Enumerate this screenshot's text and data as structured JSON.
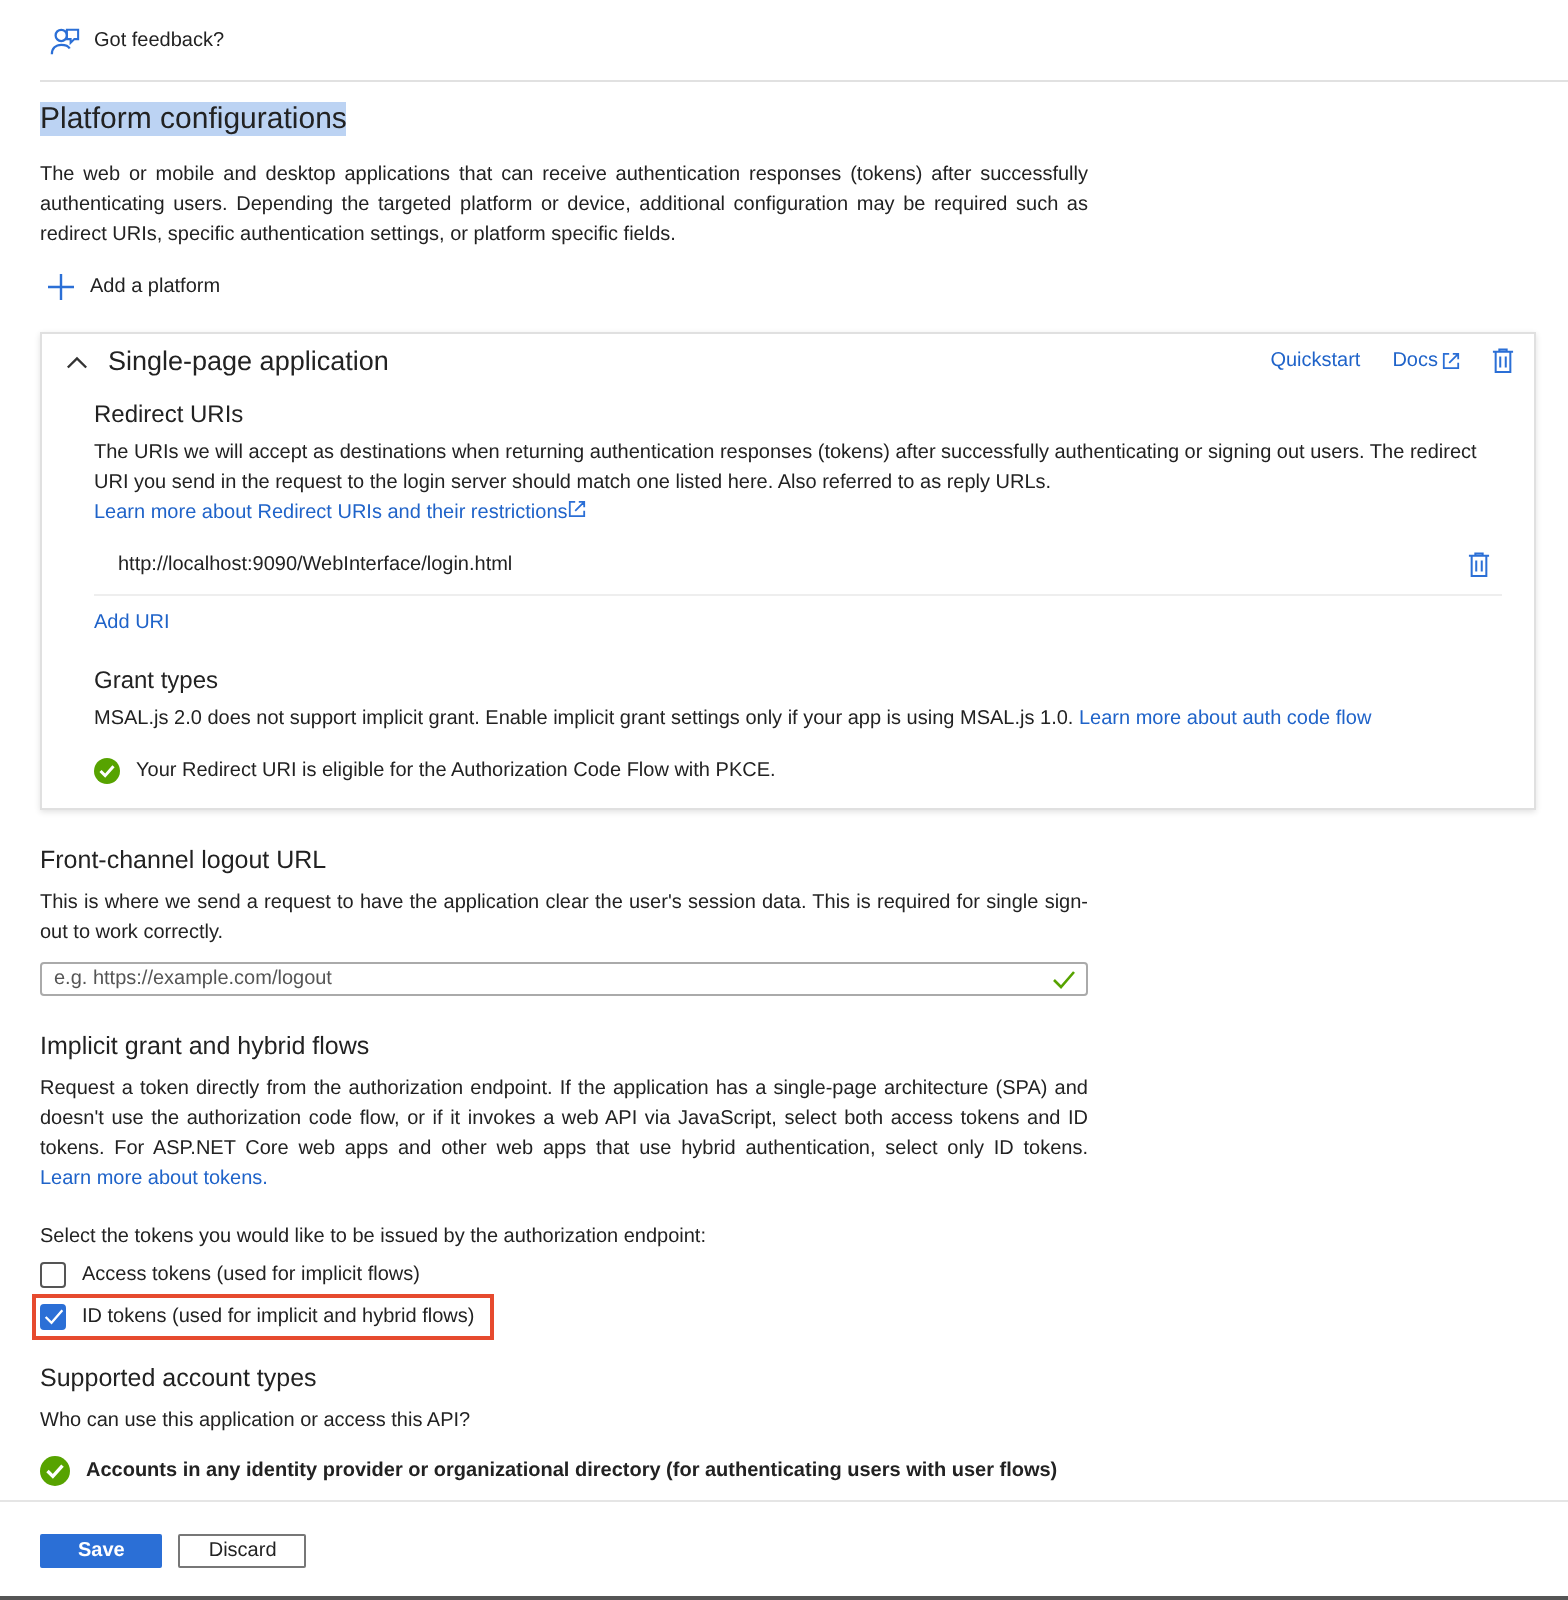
{
  "toolbar": {
    "feedback": "Got feedback?"
  },
  "title": {
    "text": "Platform configurations",
    "highlighted": true
  },
  "intro": "The web or mobile and desktop applications that can receive authentication responses (tokens) after successfully authenticating users. Depending the targeted platform or device, additional configuration may be required such as redirect URIs, specific authentication settings, or platform specific fields.",
  "add_platform": "Add a platform",
  "platform": {
    "title": "Single-page application",
    "expanded": true,
    "quickstart": "Quickstart",
    "docs": "Docs",
    "redirect_heading": "Redirect URIs",
    "redirect_text": "The URIs we will accept as destinations when returning authentication responses (tokens) after successfully authenticating or signing out users. The redirect URI you send in the request to the login server should match one listed here. Also referred to as reply URLs.",
    "redirect_link": "Learn more about Redirect URIs and their restrictions",
    "uris": [
      "http://localhost:9090/WebInterface/login.html"
    ],
    "add_uri": "Add URI",
    "grant_heading": "Grant types",
    "grant_text": "MSAL.js 2.0 does not support implicit grant. Enable implicit grant settings only if your app is using MSAL.js 1.0.",
    "grant_link": "Learn more about auth code flow",
    "eligibility": "Your Redirect URI is eligible for the Authorization Code Flow with PKCE."
  },
  "logout": {
    "heading": "Front-channel logout URL",
    "text": "This is where we send a request to have the application clear the user's session data. This is required for single sign-out to work correctly.",
    "placeholder": "e.g. https://example.com/logout",
    "valid": true
  },
  "implicit": {
    "heading": "Implicit grant and hybrid flows",
    "text": "Request a token directly from the authorization endpoint. If the application has a single-page architecture (SPA) and doesn't use the authorization code flow, or if it invokes a web API via JavaScript, select both access tokens and ID tokens. For ASP.NET Core web apps and other web apps that use hybrid authentication, select only ID tokens.",
    "link": "Learn more about tokens.",
    "prompt": "Select the tokens you would like to be issued by the authorization endpoint:",
    "tokens": [
      {
        "label": "Access tokens (used for implicit flows)",
        "checked": false,
        "highlighted": false
      },
      {
        "label": "ID tokens (used for implicit and hybrid flows)",
        "checked": true,
        "highlighted": true
      }
    ]
  },
  "accounts": {
    "heading": "Supported account types",
    "question": "Who can use this application or access this API?",
    "choice": "Accounts in any identity provider or organizational directory (for authenticating users with user flows)"
  },
  "buttons": [
    {
      "label": "Save",
      "kind": "primary"
    },
    {
      "label": "Discard",
      "kind": "secondary"
    }
  ]
}
